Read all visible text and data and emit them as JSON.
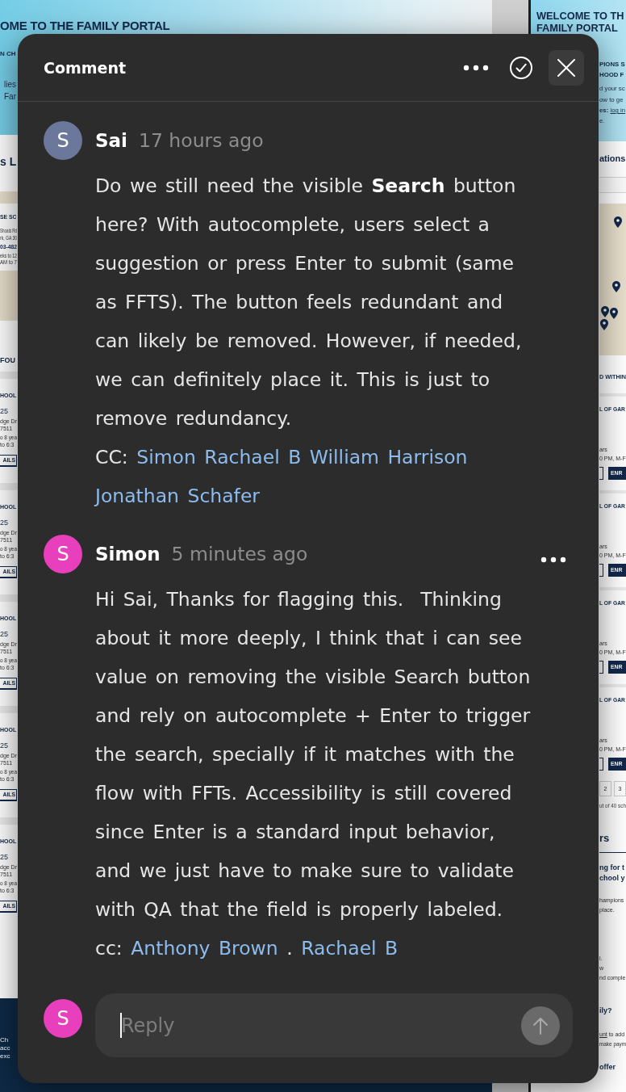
{
  "left_frame": {
    "heading": "OME TO THE FAMILY PORTAL",
    "hero_title": "N CH",
    "hero_text": [
      "lies",
      "Far"
    ],
    "section_title": "s L",
    "map_card": {
      "name": "SE SC",
      "address": [
        "Shoals Rd",
        "rk, GA 30"
      ],
      "phone": "03-482",
      "hours": [
        "eks to 12",
        "AM to 7"
      ]
    },
    "results_heading": "FOU",
    "schools": [
      {
        "name": "HOOL",
        "distance": "25",
        "address": [
          "dge Dr",
          "7511"
        ],
        "details": [
          "o 8 yea",
          "to 6:3"
        ],
        "button": "AILS"
      },
      {
        "name": "HOOL",
        "distance": "25",
        "address": [
          "dge Dr",
          "7511"
        ],
        "details": [
          "o 8 yea",
          "to 6:3"
        ],
        "button": "AILS"
      },
      {
        "name": "HOOL",
        "distance": "25",
        "address": [
          "dge Dr",
          "7511"
        ],
        "details": [
          "o 8 yea",
          "to 6:3"
        ],
        "button": "AILS"
      },
      {
        "name": "HOOL",
        "distance": "25",
        "address": [
          "dge Dr",
          "7511"
        ],
        "details": [
          "o 8 yea",
          "to 6:3"
        ],
        "button": "AILS"
      },
      {
        "name": "HOOL",
        "distance": "25",
        "address": [
          "dge Dr",
          "7511"
        ],
        "details": [
          "o 8 yea",
          "to 6:3"
        ],
        "button": "AILS"
      }
    ],
    "footer_text": [
      "Ch",
      "acc",
      "exc"
    ]
  },
  "right_frame": {
    "heading": [
      "WELCOME TO TH",
      "FAMILY PORTAL"
    ],
    "hero_title": [
      "PIONS S",
      "HOOD F"
    ],
    "hero_text": [
      {
        "kind": "text",
        "text": "d your sc"
      },
      {
        "kind": "text",
        "text": "ow to ge"
      },
      {
        "kind": "login",
        "label": "es:",
        "link": "log in"
      },
      {
        "kind": "text",
        "text": "e."
      }
    ],
    "section_title": "ations",
    "results_heading": "D WITHIN",
    "schools": [
      {
        "name": "L OF GAR",
        "details": [
          "ars",
          "0 PM, M-F"
        ],
        "button": "ENR"
      },
      {
        "name": "L OF GAR",
        "details": [
          "ars",
          "0 PM, M-F"
        ],
        "button": "ENR"
      },
      {
        "name": "L OF GAR",
        "details": [
          "ars",
          "0 PM, M-F"
        ],
        "button": "ENR"
      },
      {
        "name": "L OF GAR",
        "details": [
          "ars",
          "0 PM, M-F"
        ],
        "button": "ENR"
      }
    ],
    "pages": [
      {
        "label": "2",
        "selected": false
      },
      {
        "label": "3",
        "selected": false
      }
    ],
    "results_count": "ut of 40 sch",
    "info_heading": "rs",
    "info_title": [
      "ng for t",
      "chool y"
    ],
    "info_text": [
      "hampions",
      "place."
    ],
    "steps": [
      "l.",
      "w",
      "nd comple"
    ],
    "question": "ily?",
    "answer": [
      {
        "kind": "link",
        "link": "unt",
        "text": "to add"
      },
      {
        "kind": "text",
        "text": "make paym"
      }
    ],
    "offer": "offer"
  },
  "comment_panel": {
    "title": "Comment",
    "comments": [
      {
        "author": "Sai",
        "avatar": {
          "initial": "S",
          "color": "#6b789c"
        },
        "time": "17 hours ago",
        "more_button": false,
        "body": "Do we still need the visible **Search** button here? With autocomplete, users select a suggestion or press Enter to submit (same as FFTS). The button feels redundant and can likely be removed. However, if needed, we can definitely place it. This is just to remove redundancy.",
        "cc": [
          {
            "kind": "text",
            "text": "CC:"
          },
          {
            "kind": "mention",
            "text": "Simon"
          },
          {
            "kind": "mention",
            "text": "Rachael B"
          },
          {
            "kind": "mention",
            "text": "William Harrison"
          },
          {
            "kind": "mention",
            "text": "Jonathan Schafer"
          }
        ]
      },
      {
        "author": "Simon",
        "avatar": {
          "initial": "S",
          "color": "#e840bc"
        },
        "time": "5 minutes ago",
        "more_button": true,
        "body": "Hi Sai, Thanks for flagging this.  Thinking about it more deeply, I think that i can see value on removing the visible Search button and rely on autocomplete + Enter to trigger the search, specially if it matches with the flow with FFTs. Accessibility is still covered since Enter is a standard input behavior, and we just have to make sure to validate with QA that the field is properly labeled.",
        "cc": [
          {
            "kind": "text",
            "text": "cc:"
          },
          {
            "kind": "mention",
            "text": "Anthony Brown"
          },
          {
            "kind": "text",
            "text": "."
          },
          {
            "kind": "mention",
            "text": "Rachael B"
          }
        ]
      }
    ],
    "reply": {
      "avatar": {
        "initial": "S",
        "color": "#e840bc"
      },
      "placeholder": "Reply",
      "focused": true
    }
  }
}
